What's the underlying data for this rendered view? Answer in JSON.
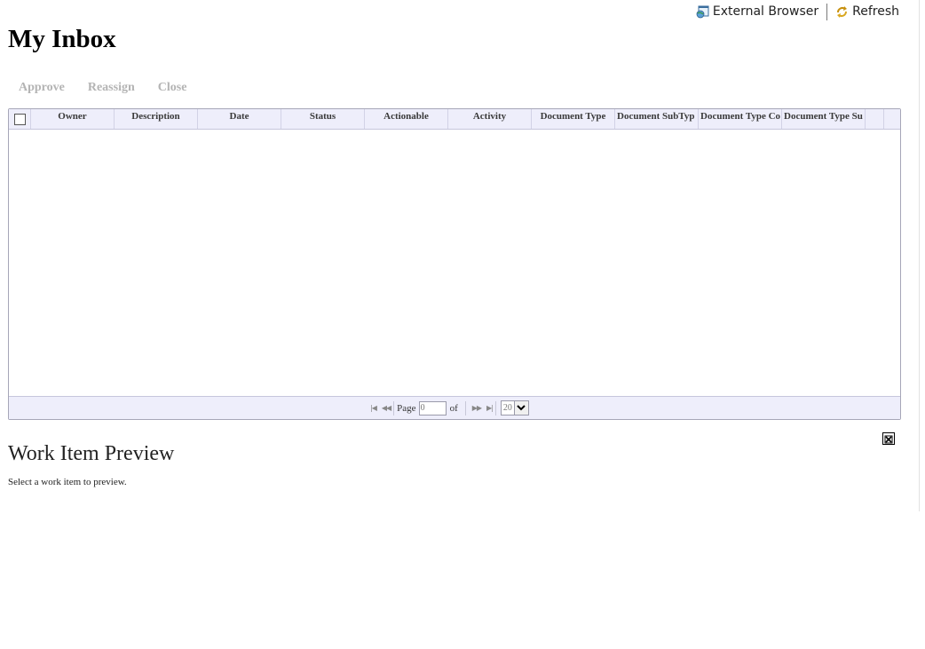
{
  "header": {
    "external_browser_label": "External Browser",
    "refresh_label": "Refresh",
    "title": "My Inbox"
  },
  "actions": {
    "approve": "Approve",
    "reassign": "Reassign",
    "close": "Close"
  },
  "grid": {
    "columns": [
      {
        "label": "Owner"
      },
      {
        "label": "Description"
      },
      {
        "label": "Date"
      },
      {
        "label": "Status"
      },
      {
        "label": "Actionable"
      },
      {
        "label": "Activity"
      },
      {
        "label": "Document Type"
      },
      {
        "label": "Document SubTyp"
      },
      {
        "label": "Document Type Co"
      },
      {
        "label": "Document Type Su"
      }
    ],
    "rows": [],
    "pager": {
      "page_label": "Page",
      "page_value": "0",
      "of_label": "of",
      "page_size": "20"
    }
  },
  "preview": {
    "title": "Work Item Preview",
    "hint": "Select a work item to preview."
  },
  "icons": {
    "external_browser": "globe-window-icon",
    "refresh": "refresh-arrows-icon",
    "first_page": "first-page-icon",
    "prev_page": "prev-page-icon",
    "next_page": "next-page-icon",
    "last_page": "last-page-icon",
    "close_preview": "close-box-icon"
  },
  "colors": {
    "grid_header_bg": "#eeeefb",
    "disabled_action": "#b4b4b4"
  }
}
